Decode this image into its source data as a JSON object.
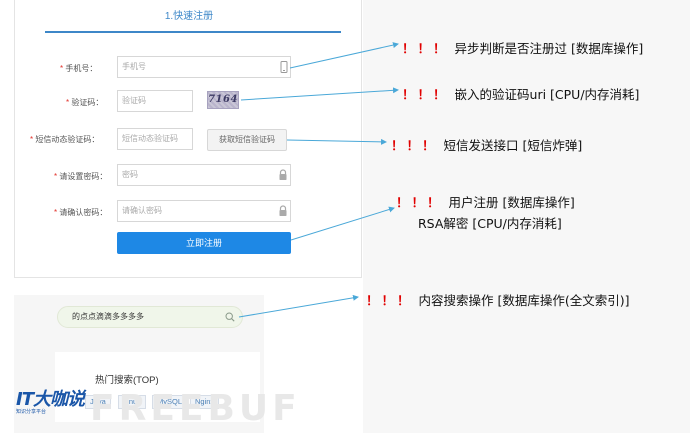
{
  "register": {
    "step_tab": "1.快速注册",
    "phone_label": "手机号：",
    "phone_placeholder": "手机号",
    "captcha_label": "验证码：",
    "captcha_placeholder": "验证码",
    "captcha_text": "7164",
    "sms_label": "短信动态验证码：",
    "sms_placeholder": "短信动态验证码",
    "sms_button": "获取短信验证码",
    "password_label": "请设置密码：",
    "password_placeholder": "密码",
    "confirm_label": "请确认密码：",
    "confirm_placeholder": "请确认密码",
    "submit": "立即注册"
  },
  "search": {
    "query": "的点点滴滴多多多多",
    "hot_title": "热门搜索(TOP)",
    "tags": [
      "Java",
      "Linux",
      "MySQL",
      "Nginx"
    ]
  },
  "brand": {
    "logo": "IT大咖说",
    "logo_sub": "知识分享平台",
    "watermark": "FREEBUF"
  },
  "annotations": {
    "bang": "！！！",
    "a1": "异步判断是否注册过 [数据库操作]",
    "a2": "嵌入的验证码uri [CPU/内存消耗]",
    "a3": "短信发送接口 [短信炸弹]",
    "a4_line1": "用户注册 [数据库操作]",
    "a4_line2": "RSA解密 [CPU/内存消耗]",
    "a5": "内容搜索操作 [数据库操作(全文索引)]"
  },
  "colors": {
    "accent": "#1e88e5",
    "required": "#e2322b",
    "annotation_bang": "#e00000",
    "arrow": "#4aa8d8"
  }
}
